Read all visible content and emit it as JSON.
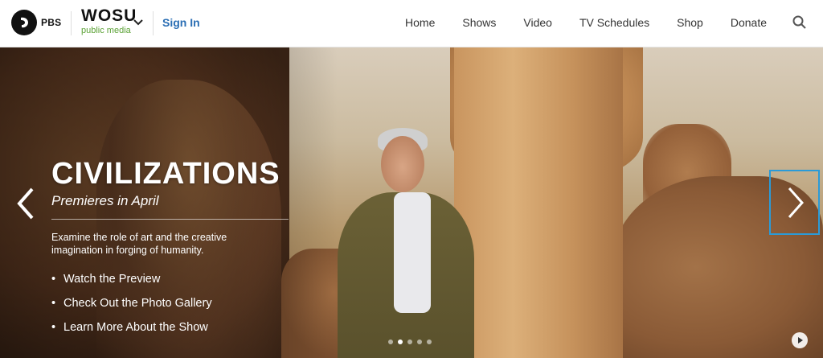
{
  "header": {
    "pbs_label": "PBS",
    "station_name": "WOSU",
    "station_sub": "public media",
    "signin_label": "Sign In",
    "nav": [
      "Home",
      "Shows",
      "Video",
      "TV Schedules",
      "Shop",
      "Donate"
    ],
    "search_icon": "search-icon"
  },
  "hero": {
    "title": "CIVILIZATIONS",
    "subtitle": "Premieres in April",
    "description": "Examine the role of art and the creative imagination in forging of humanity.",
    "links": [
      "Watch the Preview",
      "Check Out the Photo Gallery",
      "Learn More About the Show"
    ],
    "slides_count": 5,
    "active_slide": 2
  },
  "colors": {
    "signin": "#2a6eb4",
    "station_sub": "#5aa134",
    "focus_outline": "#2a9bd8"
  }
}
